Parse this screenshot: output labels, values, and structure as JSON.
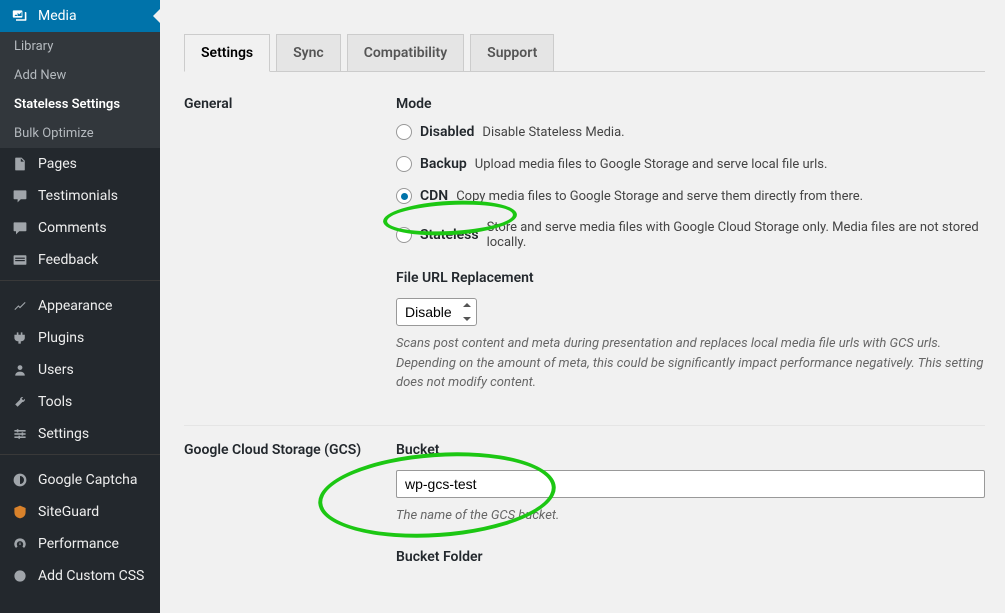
{
  "sidebar": {
    "media": {
      "label": "Media",
      "sub": [
        {
          "label": "Library",
          "current": false
        },
        {
          "label": "Add New",
          "current": false
        },
        {
          "label": "Stateless Settings",
          "current": true
        },
        {
          "label": "Bulk Optimize",
          "current": false
        }
      ]
    },
    "items": [
      {
        "label": "Pages",
        "icon": "pages"
      },
      {
        "label": "Testimonials",
        "icon": "testimonials"
      },
      {
        "label": "Comments",
        "icon": "comments"
      },
      {
        "label": "Feedback",
        "icon": "feedback"
      }
    ],
    "items2": [
      {
        "label": "Appearance",
        "icon": "appearance"
      },
      {
        "label": "Plugins",
        "icon": "plugins"
      },
      {
        "label": "Users",
        "icon": "users"
      },
      {
        "label": "Tools",
        "icon": "tools"
      },
      {
        "label": "Settings",
        "icon": "settings"
      }
    ],
    "items3": [
      {
        "label": "Google Captcha",
        "icon": "captcha"
      },
      {
        "label": "SiteGuard",
        "icon": "siteguard"
      },
      {
        "label": "Performance",
        "icon": "performance"
      },
      {
        "label": "Add Custom CSS",
        "icon": "css"
      }
    ]
  },
  "tabs": [
    {
      "label": "Settings",
      "active": true
    },
    {
      "label": "Sync",
      "active": false
    },
    {
      "label": "Compatibility",
      "active": false
    },
    {
      "label": "Support",
      "active": false
    }
  ],
  "section_general": "General",
  "mode": {
    "title": "Mode",
    "options": [
      {
        "name": "disabled",
        "label": "Disabled",
        "desc": "Disable Stateless Media.",
        "checked": false
      },
      {
        "name": "backup",
        "label": "Backup",
        "desc": "Upload media files to Google Storage and serve local file urls.",
        "checked": false
      },
      {
        "name": "cdn",
        "label": "CDN",
        "desc": "Copy media files to Google Storage and serve them directly from there.",
        "checked": true
      },
      {
        "name": "stateless",
        "label": "Stateless",
        "desc": "Store and serve media files with Google Cloud Storage only. Media files are not stored locally.",
        "checked": false
      }
    ]
  },
  "file_url": {
    "title": "File URL Replacement",
    "selected": "Disable",
    "desc": "Scans post content and meta during presentation and replaces local media file urls with GCS urls. Depending on the amount of meta, this could be significantly impact performance negatively. This setting does not modify content."
  },
  "section_gcs": "Google Cloud Storage (GCS)",
  "bucket": {
    "title": "Bucket",
    "value": "wp-gcs-test",
    "desc": "The name of the GCS bucket."
  },
  "bucket_folder": {
    "title": "Bucket Folder"
  }
}
